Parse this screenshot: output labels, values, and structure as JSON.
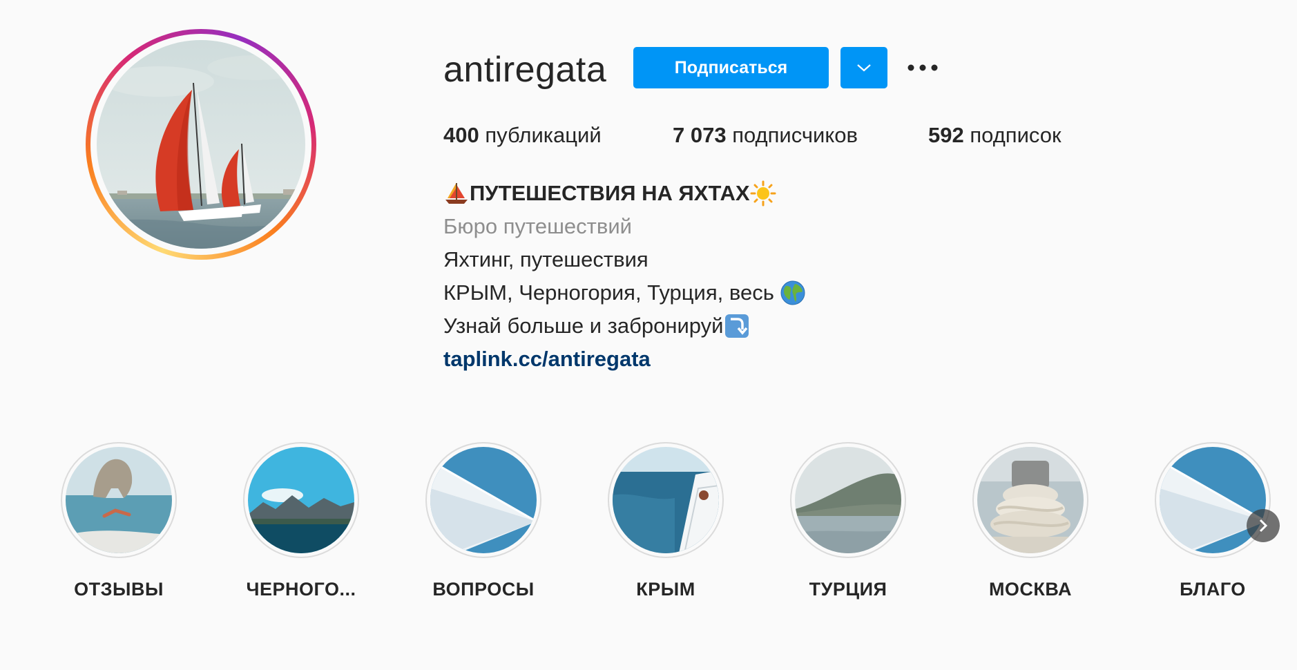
{
  "profile": {
    "username": "antiregata",
    "follow_label": "Подписаться",
    "dropdown_icon": "chevron-down-icon",
    "more_icon": "more-options-icon",
    "avatar_icon": "sailboats-photo"
  },
  "stats": {
    "posts": {
      "count": "400",
      "label": "публикаций"
    },
    "followers": {
      "count": "7 073",
      "label": "подписчиков"
    },
    "following": {
      "count": "592",
      "label": "подписок"
    }
  },
  "bio": {
    "title": "ПУТЕШЕСТВИЯ НА ЯХТАХ",
    "category": "Бюро путешествий",
    "line1": "Яхтинг, путешествия",
    "line2": "КРЫМ, Черногория, Турция, весь",
    "line3": "Узнай больше и забронируй",
    "link": "taplink.cc/antiregata",
    "emojis": [
      "sailboat-emoji",
      "sun-emoji",
      "globe-emoji",
      "arrow-down-emoji"
    ]
  },
  "highlights": [
    {
      "label": "ОТЗЫВЫ",
      "icon": "diver-rock-photo"
    },
    {
      "label": "ЧЕРНОГО...",
      "icon": "mountain-bay-photo"
    },
    {
      "label": "ВОПРОСЫ",
      "icon": "sail-photo"
    },
    {
      "label": "КРЫМ",
      "icon": "yacht-sea-photo"
    },
    {
      "label": "ТУРЦИЯ",
      "icon": "hills-sea-photo"
    },
    {
      "label": "МОСКВА",
      "icon": "rope-photo"
    },
    {
      "label": "БЛАГО",
      "icon": "sail-photo"
    }
  ],
  "colors": {
    "accent": "#0095f6",
    "link": "#00376b",
    "muted": "#8e8e8e",
    "text": "#262626",
    "background": "#fafafa"
  },
  "next_icon": "chevron-right-icon"
}
